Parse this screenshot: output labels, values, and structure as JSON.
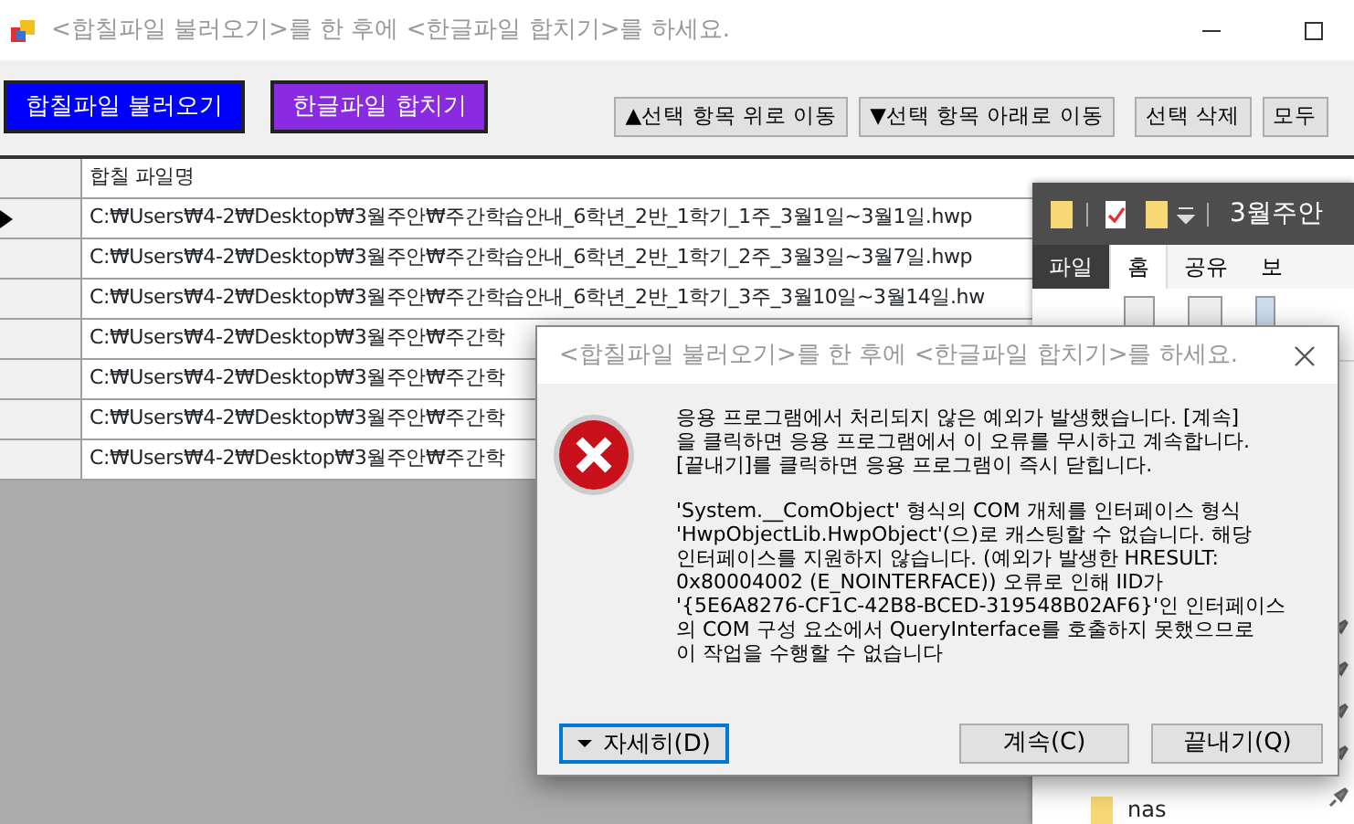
{
  "main_window": {
    "title": "<합칠파일 불러오기>를 한 후에 <한글파일 합치기>를 하세요."
  },
  "toolbar": [
    {
      "label": "합칠파일 불러오기",
      "kind": "large",
      "color": "#0000ff"
    },
    {
      "label": "한글파일 합치기",
      "kind": "large",
      "color": "#8a2be2"
    },
    {
      "label": "▲선택 항목 위로 이동",
      "kind": "small"
    },
    {
      "label": "▼선택 항목 아래로 이동",
      "kind": "small"
    },
    {
      "label": "선택 삭제",
      "kind": "small"
    },
    {
      "label": "모두",
      "kind": "small"
    }
  ],
  "grid": {
    "columns": [
      "합칠 파일명"
    ],
    "rows": [
      {
        "path": "C:₩Users₩4-2₩Desktop₩3월주안₩주간학습안내_6학년_2반_1학기_1주_3월1일~3월1일.hwp",
        "selected": true
      },
      {
        "path": "C:₩Users₩4-2₩Desktop₩3월주안₩주간학습안내_6학년_2반_1학기_2주_3월3일~3월7일.hwp",
        "selected": false
      },
      {
        "path": "C:₩Users₩4-2₩Desktop₩3월주안₩주간학습안내_6학년_2반_1학기_3주_3월10일~3월14일.hw",
        "selected": false
      },
      {
        "path": "C:₩Users₩4-2₩Desktop₩3월주안₩주간학",
        "selected": false
      },
      {
        "path": "C:₩Users₩4-2₩Desktop₩3월주안₩주간학",
        "selected": false
      },
      {
        "path": "C:₩Users₩4-2₩Desktop₩3월주안₩주간학",
        "selected": false
      },
      {
        "path": "C:₩Users₩4-2₩Desktop₩3월주안₩주간학",
        "selected": false
      }
    ]
  },
  "explorer": {
    "title": "3월주안",
    "tabs": [
      {
        "label": "파일",
        "kind": "file",
        "selected": false
      },
      {
        "label": "홈",
        "kind": "tab",
        "selected": true
      },
      {
        "label": "공유",
        "kind": "tab",
        "selected": false
      },
      {
        "label": "보",
        "kind": "tab",
        "selected": false
      }
    ],
    "items": [
      {
        "label": "nas"
      }
    ]
  },
  "dialog": {
    "title": "<합칠파일 불러오기>를 한 후에 <한글파일 합치기>를 하세요.",
    "message": [
      [
        "응용 프로그램에서 처리되지 않은 예외가 발생했습니다. [계속]",
        "을 클릭하면 응용 프로그램에서 이 오류를 무시하고 계속합니다.",
        "[끝내기]를 클릭하면 응용 프로그램이 즉시 닫힙니다."
      ],
      [
        "'System.__ComObject' 형식의 COM 개체를 인터페이스 형식",
        "'HwpObjectLib.HwpObject'(으)로 캐스팅할 수 없습니다. 해당",
        "인터페이스를 지원하지 않습니다. (예외가 발생한 HRESULT:",
        "0x80004002 (E_NOINTERFACE)) 오류로 인해 IID가",
        "'{5E6A8276-CF1C-42B8-BCED-319548B02AF6}'인 인터페이스",
        "의 COM 구성 요소에서 QueryInterface를 호출하지 못했으므로",
        "이 작업을 수행할 수 없습니다"
      ]
    ],
    "buttons": [
      {
        "label": "자세히(D)",
        "kind": "details",
        "focused": true
      },
      {
        "label": "계속(C)",
        "kind": "plain",
        "focused": false
      },
      {
        "label": "끝내기(Q)",
        "kind": "plain",
        "focused": false
      }
    ]
  }
}
